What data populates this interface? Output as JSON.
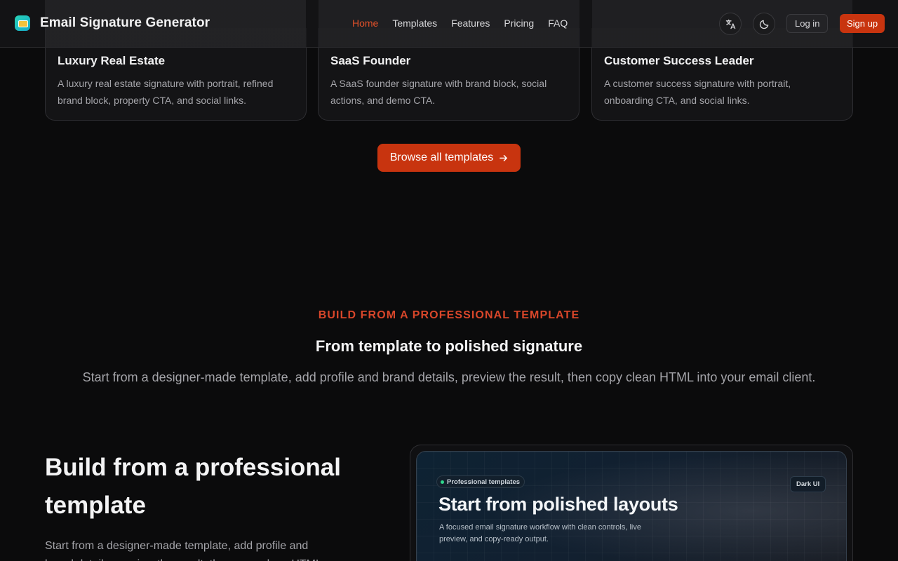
{
  "header": {
    "brand_name": "Email Signature Generator",
    "nav": [
      "Home",
      "Templates",
      "Features",
      "Pricing",
      "FAQ"
    ],
    "active_nav": "Home",
    "login_label": "Log in",
    "signup_label": "Sign up",
    "icons": [
      "translate-icon",
      "moon-icon"
    ]
  },
  "templates": [
    {
      "title": "Luxury Real Estate",
      "description": "A luxury real estate signature with portrait, refined brand block, property CTA, and social links."
    },
    {
      "title": "SaaS Founder",
      "description": "A SaaS founder signature with brand block, social actions, and demo CTA."
    },
    {
      "title": "Customer Success Leader",
      "description": "A customer success signature with portrait, onboarding CTA, and social links."
    }
  ],
  "browse_label": "Browse all templates",
  "section": {
    "eyebrow": "BUILD FROM A PROFESSIONAL TEMPLATE",
    "title": "From template to polished signature",
    "subtitle": "Start from a designer-made template, add profile and brand details, preview the result, then copy clean HTML into your email client."
  },
  "feature": {
    "title": "Build from a professional template",
    "description": "Start from a designer-made template, add profile and brand details, preview the result, then copy clean HTML",
    "preview": {
      "pill": "Professional templates",
      "badge": "Dark UI",
      "title": "Start from polished layouts",
      "description": "A focused email signature workflow with clean controls, live preview, and copy-ready output."
    }
  },
  "colors": {
    "accent": "#c8340f",
    "accent_text": "#d8462a",
    "background": "#0b0b0c"
  }
}
